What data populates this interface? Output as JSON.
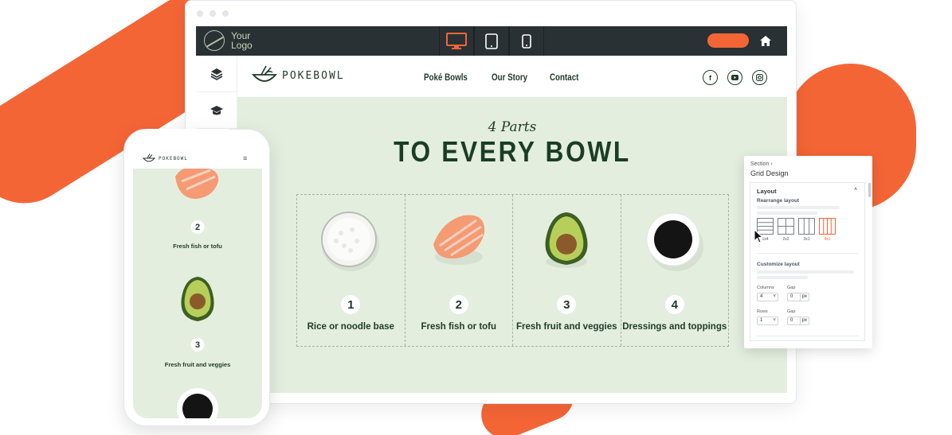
{
  "toolbar": {
    "logo_line1": "Your",
    "logo_line2": "Logo",
    "devices": [
      {
        "name": "desktop",
        "active": true
      },
      {
        "name": "tablet",
        "active": false
      },
      {
        "name": "mobile",
        "active": false
      }
    ],
    "accent": "#f46536",
    "background": "#2a3134"
  },
  "site": {
    "brand": "POKEBOWL",
    "nav": [
      "Poké Bowls",
      "Our Story",
      "Contact"
    ],
    "social_icons": [
      "facebook-icon",
      "youtube-icon",
      "instagram-icon"
    ],
    "kicker": "4 Parts",
    "title": "TO EVERY BOWL",
    "items": [
      {
        "number": "1",
        "label": "Rice or noodle base",
        "icon": "rice-bowl"
      },
      {
        "number": "2",
        "label": "Fresh fish or tofu",
        "icon": "salmon"
      },
      {
        "number": "3",
        "label": "Fresh fruit and veggies",
        "icon": "avocado"
      },
      {
        "number": "4",
        "label": "Dressings and toppings",
        "icon": "soy-sauce"
      }
    ],
    "hero_bg": "#e3eedf",
    "text_color": "#1f3a28"
  },
  "grid_panel": {
    "breadcrumb": "Section",
    "title": "Grid Design",
    "layout_heading": "Layout",
    "rearrange_label": "Rearrange layout",
    "layout_options": [
      "1x4",
      "2x2",
      "3x1",
      "4x1"
    ],
    "customize_label": "Customize layout",
    "columns_label": "Columns",
    "columns_value": "4",
    "col_gap_label": "Gap",
    "col_gap_value": "0",
    "rows_label": "Rows",
    "rows_value": "1",
    "row_gap_label": "Gap",
    "row_gap_value": "0",
    "unit": "px"
  },
  "phone": {
    "brand": "POKEBOWL",
    "items": [
      {
        "number": "2",
        "label": "Fresh fish or tofu"
      },
      {
        "number": "3",
        "label": "Fresh fruit and veggies"
      }
    ]
  }
}
